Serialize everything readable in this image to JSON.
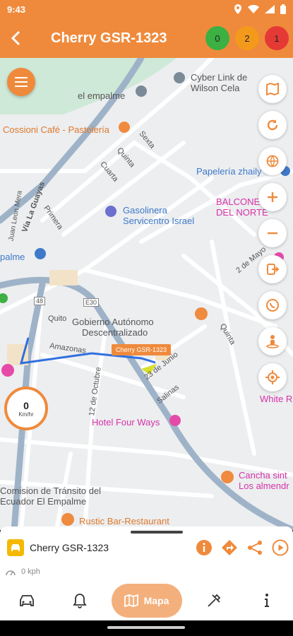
{
  "status_bar": {
    "time": "9:43",
    "icons": [
      "location-icon",
      "wifi-icon",
      "signal-icon",
      "battery-icon"
    ]
  },
  "header": {
    "title": "Cherry GSR-1323",
    "badges": [
      {
        "value": "0",
        "color": "#3cb043"
      },
      {
        "value": "2",
        "color": "#f39a1c"
      },
      {
        "value": "1",
        "color": "#e53935"
      }
    ]
  },
  "map": {
    "labels": {
      "cyber_link_1": "Cyber Link de",
      "cyber_link_2": "Wilson Cela",
      "el_empalme": "el empalme",
      "cossioni": "Cossioni Café - Pastelería",
      "papeleria": "Papelería zhaily",
      "balcone_1": "BALCONE",
      "balcone_2": "DEL NORTE",
      "gasolinera_1": "Gasolinera",
      "gasolinera_2": "Servicentro Israel",
      "empalme_left": "palme",
      "quito": "Quito",
      "gobierno_1": "Gobierno Autónomo",
      "gobierno_2": "Descentralizado",
      "hotel": "Hotel Four Ways",
      "white": "White R",
      "cancha_1": "Cancha sint",
      "cancha_2": "Los almendr",
      "comision_1": "Comision de Tránsito del",
      "comision_2": "Ecuador El Empalme",
      "rustic": "Rustic Bar-Restaurant"
    },
    "streets": {
      "sexta": "Sexta",
      "quinta_1": "Quinta",
      "cuarta": "Cuarta",
      "via_guayas": "Vía La Guayas",
      "primera": "Primera",
      "juan_leon_mera": "Juan Leon Mera",
      "dos_mayo": "2 de Mayo",
      "quinta_2": "Quinta",
      "amazonas": "Amazonas",
      "octubre": "12 de Octubre",
      "junio": "23 de Junio",
      "salinas": "Salinas",
      "e30": "E30",
      "r48": "48"
    },
    "vehicle_tag": "Cherry GSR-1323",
    "speed_gauge": {
      "value": "0",
      "unit": "Km/hr"
    }
  },
  "side_tools": [
    "map-layers-icon",
    "refresh-icon",
    "globe-icon",
    "zoom-in-icon",
    "zoom-out-icon",
    "exit-icon",
    "whatsapp-icon",
    "street-view-icon",
    "my-location-icon"
  ],
  "bottom_sheet": {
    "vehicle_name": "Cherry GSR-1323",
    "speed_text": "0 kph"
  },
  "nav": {
    "active_label": "Mapa"
  },
  "colors": {
    "accent": "#ef8a3c",
    "route": "#2f6fe0"
  }
}
